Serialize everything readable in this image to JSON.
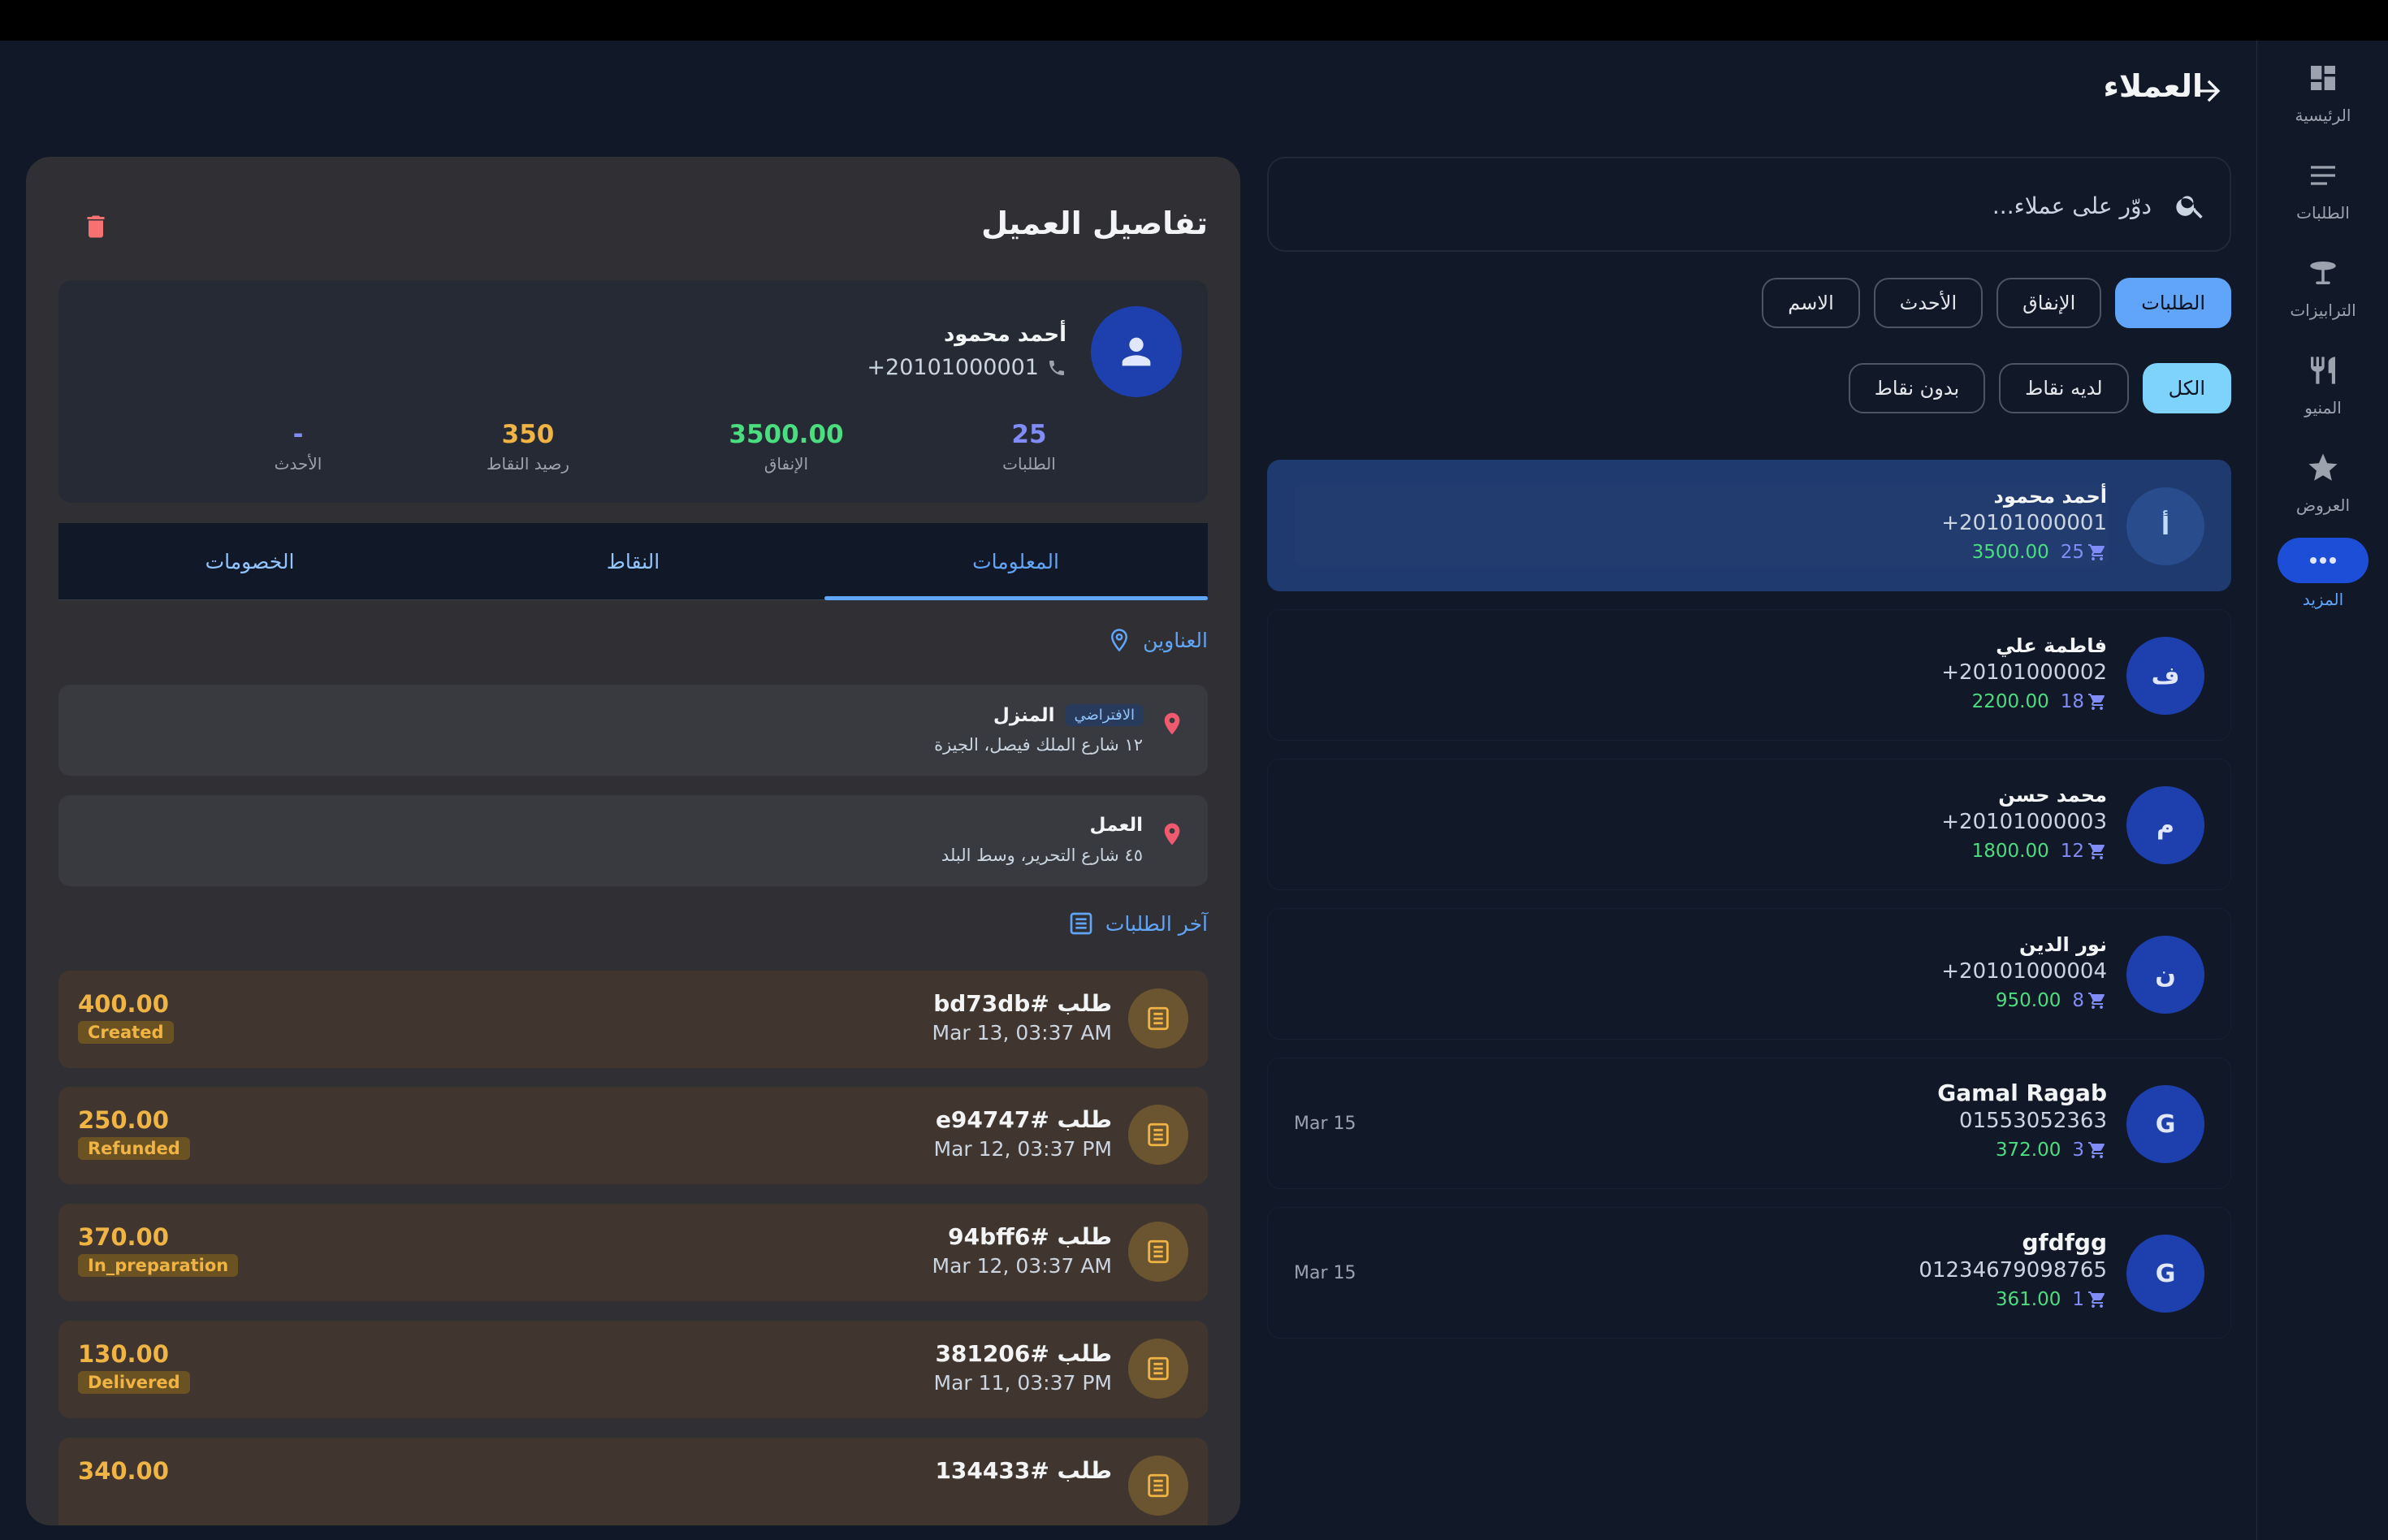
{
  "header": {
    "title": "العملاء"
  },
  "rail": {
    "items": [
      {
        "label": "الرئيسية",
        "icon": "dashboard-icon"
      },
      {
        "label": "الطلبات",
        "icon": "list-icon"
      },
      {
        "label": "الترابيزات",
        "icon": "table-icon"
      },
      {
        "label": "المنيو",
        "icon": "restaurant-icon"
      },
      {
        "label": "العروض",
        "icon": "star-icon"
      },
      {
        "label": "المزيد",
        "icon": "more-icon",
        "active": true
      }
    ]
  },
  "search": {
    "placeholder": "دوّر على عملاء..."
  },
  "sort_chips": {
    "orders": "الطلبات",
    "spend": "الإنفاق",
    "latest": "الأحدث",
    "name": "الاسم"
  },
  "filter_chips": {
    "all": "الكل",
    "has_points": "لديه نقاط",
    "no_points": "بدون نقاط"
  },
  "customers": [
    {
      "initial": "أ",
      "name": "أحمد محمود",
      "phone": "+20101000001",
      "orders": "25",
      "spend": "3500.00",
      "date": ""
    },
    {
      "initial": "ف",
      "name": "فاطمة علي",
      "phone": "+20101000002",
      "orders": "18",
      "spend": "2200.00",
      "date": ""
    },
    {
      "initial": "م",
      "name": "محمد حسن",
      "phone": "+20101000003",
      "orders": "12",
      "spend": "1800.00",
      "date": ""
    },
    {
      "initial": "ن",
      "name": "نور الدين",
      "phone": "+20101000004",
      "orders": "8",
      "spend": "950.00",
      "date": ""
    },
    {
      "initial": "G",
      "name": "Gamal Ragab",
      "phone": "01553052363",
      "orders": "3",
      "spend": "372.00",
      "date": "Mar 15"
    },
    {
      "initial": "G",
      "name": "gfdfgg",
      "phone": "01234679098765",
      "orders": "1",
      "spend": "361.00",
      "date": "Mar 15"
    }
  ],
  "details": {
    "title": "تفاصيل العميل",
    "name": "أحمد محمود",
    "phone": "+20101000001",
    "stats": {
      "orders_value": "25",
      "orders_label": "الطلبات",
      "spend_value": "3500.00",
      "spend_label": "الإنفاق",
      "points_value": "350",
      "points_label": "رصيد النقاط",
      "latest_value": "-",
      "latest_label": "الأحدث"
    },
    "tabs": {
      "info": "المعلومات",
      "points": "النقاط",
      "discounts": "الخصومات"
    },
    "addresses_title": "العناوين",
    "addresses": [
      {
        "label": "المنزل",
        "badge": "الافتراضي",
        "line": "١٢ شارع الملك فيصل، الجيزة"
      },
      {
        "label": "العمل",
        "badge": "",
        "line": "٤٥ شارع التحرير، وسط البلد"
      }
    ],
    "orders_title": "آخر الطلبات",
    "orders": [
      {
        "number": "طلب #bd73db",
        "date": "Mar 13, 03:37 AM",
        "total": "400.00",
        "status": "Created"
      },
      {
        "number": "طلب #e94747",
        "date": "Mar 12, 03:37 PM",
        "total": "250.00",
        "status": "Refunded"
      },
      {
        "number": "طلب #94bff6",
        "date": "Mar 12, 03:37 AM",
        "total": "370.00",
        "status": "In_preparation"
      },
      {
        "number": "طلب #381206",
        "date": "Mar 11, 03:37 PM",
        "total": "130.00",
        "status": "Delivered"
      },
      {
        "number": "طلب #134433",
        "date": "",
        "total": "340.00",
        "status": ""
      }
    ]
  },
  "colors": {
    "background": "#111827",
    "panel": "#303034",
    "accent": "#60a5fa",
    "spend": "#4ade80",
    "orders": "#818cf8",
    "points": "#f0b445"
  }
}
